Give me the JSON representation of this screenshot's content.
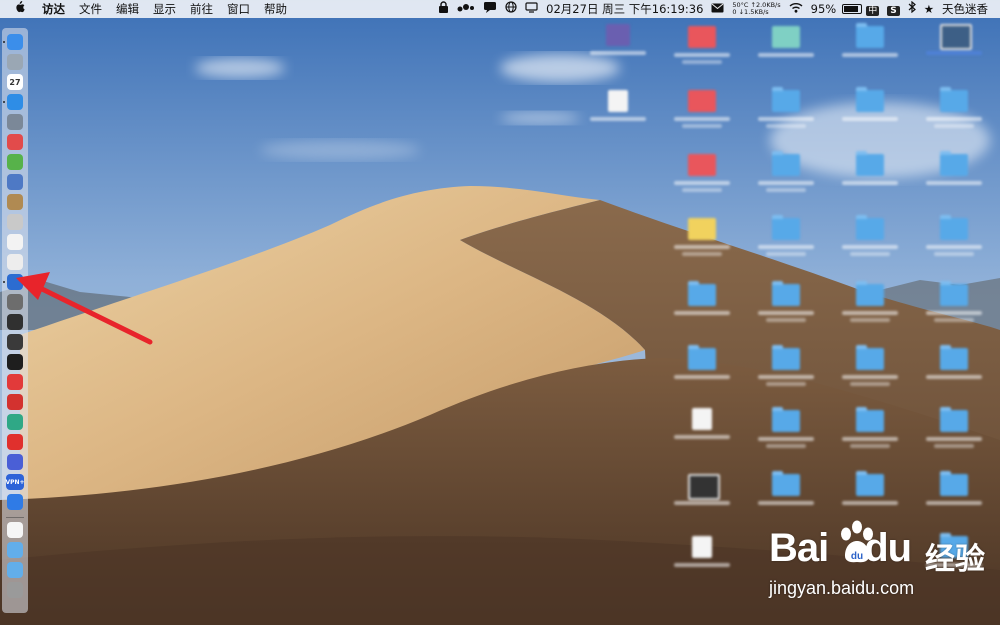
{
  "menubar": {
    "apple_icon": "apple-logo-icon",
    "app_name": "访达",
    "menus": [
      "文件",
      "编辑",
      "显示",
      "前往",
      "窗口",
      "帮助"
    ],
    "status": {
      "lock_icon": "lock-icon",
      "dots_icon": "dots-icon",
      "wechat_icon": "chat-icon",
      "globe_icon": "globe-icon",
      "display_icon": "display-icon",
      "clock": "02月27日 周三 下午16:19:36",
      "mail_icon": "mail-icon",
      "net_line1": "50°C ↑2.0KB/s",
      "net_line2": "0 ↓1.5KB/s",
      "wifi_icon": "wifi-icon",
      "battery": "95%",
      "battery_icon": "battery-icon",
      "input_badge": "中",
      "s_badge": "S",
      "bluetooth_icon": "bluetooth-icon",
      "star_icon": "star-icon",
      "user_name": "天色迷香"
    }
  },
  "dock": {
    "items": [
      {
        "name": "finder-icon",
        "color": "#3b8eea"
      },
      {
        "name": "launchpad-icon",
        "color": "#9aa7b4"
      },
      {
        "name": "calendar-icon",
        "color": "#ffffff",
        "label": "27"
      },
      {
        "name": "safari-icon",
        "color": "#2e8de6"
      },
      {
        "name": "rocket-icon",
        "color": "#7b8898"
      },
      {
        "name": "pdf-app-icon",
        "color": "#e24b4b"
      },
      {
        "name": "android-icon",
        "color": "#57b24a"
      },
      {
        "name": "preview-icon",
        "color": "#4e79c5"
      },
      {
        "name": "archive-icon",
        "color": "#b08a52"
      },
      {
        "name": "script-editor-icon",
        "color": "#c9c9c9"
      },
      {
        "name": "notes-icon",
        "color": "#f3f3f3"
      },
      {
        "name": "textedit-icon",
        "color": "#ededed"
      },
      {
        "name": "network-utility-icon",
        "color": "#2c6cd1"
      },
      {
        "name": "system-preferences-icon",
        "color": "#6d6d6d"
      },
      {
        "name": "activity-monitor-icon",
        "color": "#303030"
      },
      {
        "name": "console-icon",
        "color": "#3a3a3a"
      },
      {
        "name": "terminal-icon",
        "color": "#1e1e1e"
      },
      {
        "name": "vivaldi-icon",
        "color": "#e23a3a"
      },
      {
        "name": "netease-music-icon",
        "color": "#d3322f"
      },
      {
        "name": "web-icon",
        "color": "#2fa886"
      },
      {
        "name": "yandex-browser-icon",
        "color": "#e0302d"
      },
      {
        "name": "shield-vpn-icon",
        "color": "#4a5fd6"
      },
      {
        "name": "vpn-plus-icon",
        "color": "#2d63d8",
        "label": "VPN+"
      },
      {
        "name": "baidu-netdisk-icon",
        "color": "#2f7be6"
      },
      {
        "name": "document-icon",
        "color": "#f6f6f6"
      },
      {
        "name": "folder-icon",
        "color": "#62aeea"
      },
      {
        "name": "downloads-folder-icon",
        "color": "#62aeea"
      },
      {
        "name": "trash-icon",
        "color": "#9a9a9a"
      }
    ]
  },
  "watermark": {
    "brand": "Bai",
    "brand_suffix": "du",
    "cn_label": "经验",
    "url": "jingyan.baidu.com",
    "paw_icon": "baidu-paw-icon"
  },
  "annotation": {
    "arrow_icon": "red-arrow-icon",
    "arrow_color": "#e8242b"
  }
}
